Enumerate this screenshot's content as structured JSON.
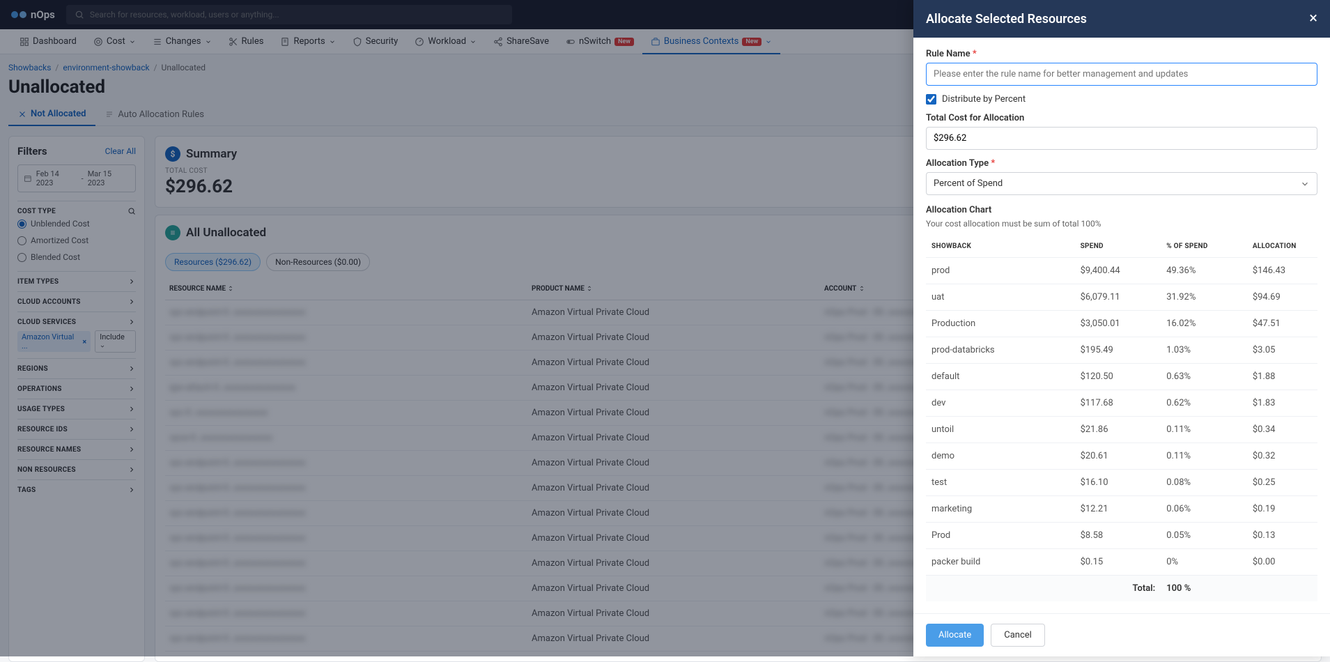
{
  "app": {
    "name": "nOps"
  },
  "search": {
    "placeholder": "Search for resources, workload, users or anything..."
  },
  "nav": {
    "dashboard": "Dashboard",
    "cost": "Cost",
    "changes": "Changes",
    "rules": "Rules",
    "reports": "Reports",
    "security": "Security",
    "workload": "Workload",
    "sharesave": "ShareSave",
    "nswitch": "nSwitch",
    "business": "Business Contexts",
    "badge_new": "New"
  },
  "breadcrumb": {
    "root": "Showbacks",
    "mid": "environment-showback",
    "leaf": "Unallocated",
    "sep": "/"
  },
  "page_title": "Unallocated",
  "tabs": {
    "not": "Not Allocated",
    "auto": "Auto Allocation Rules"
  },
  "filters": {
    "title": "Filters",
    "clear": "Clear All",
    "date_from": "Feb 14 2023",
    "date_sep": "-",
    "date_to": "Mar 15 2023",
    "cost_type": "COST TYPE",
    "opt_unblended": "Unblended Cost",
    "opt_amortized": "Amortized Cost",
    "opt_blended": "Blended Cost",
    "item_types": "ITEM TYPES",
    "cloud_accounts": "CLOUD ACCOUNTS",
    "cloud_services": "CLOUD SERVICES",
    "chip": "Amazon Virtual ...",
    "include": "Include",
    "regions": "REGIONS",
    "operations": "OPERATIONS",
    "usage_types": "USAGE TYPES",
    "resource_ids": "RESOURCE IDS",
    "resource_names": "RESOURCE NAMES",
    "non_resources": "NON RESOURCES",
    "tags": "TAGS"
  },
  "summary": {
    "title": "Summary",
    "total_label": "TOTAL COST",
    "total_value": "$296.62"
  },
  "all": {
    "title": "All Unallocated",
    "pill_resources": "Resources ($296.62)",
    "pill_non": "Non-Resources ($0.00)",
    "th_resource": "Resource Name",
    "th_product": "Product Name",
    "th_account": "Account",
    "product": "Amazon Virtual Private Cloud",
    "rows": [
      "vpc-endpoint-0..",
      "vpc-endpoint-0..",
      "vpc-endpoint-0..",
      "igw-attach-0..",
      "vpc-0..",
      "vpce-0..",
      "vpc-endpoint-0..",
      "vpc-endpoint-0..",
      "vpc-endpoint-0..",
      "vpc-endpoint-0..",
      "vpc-endpoint-0..",
      "vpc-endpoint-0..",
      "vpc-endpoint-0..",
      "vpc-endpoint-0.."
    ],
    "account": "nOps Prod - 00.."
  },
  "panel": {
    "title": "Allocate Selected Resources",
    "rule_name_label": "Rule Name",
    "rule_placeholder": "Please enter the rule name for better management and updates",
    "distribute": "Distribute by Percent",
    "total_cost_label": "Total Cost for Allocation",
    "total_cost_value": "$296.62",
    "alloc_type_label": "Allocation Type",
    "alloc_type_value": "Percent of Spend",
    "chart_title": "Allocation Chart",
    "chart_sub": "Your cost allocation must be sum of total 100%",
    "th_showback": "SHOWBACK",
    "th_spend": "SPEND",
    "th_pct": "% OF SPEND",
    "th_alloc": "ALLOCATION",
    "total_label": "Total:",
    "total_pct": "100 %",
    "btn_allocate": "Allocate",
    "btn_cancel": "Cancel"
  },
  "chart_data": {
    "type": "table",
    "columns": [
      "SHOWBACK",
      "SPEND",
      "% OF SPEND",
      "ALLOCATION"
    ],
    "rows": [
      {
        "showback": "prod",
        "spend": "$9,400.44",
        "pct": "49.36%",
        "alloc": "$146.43"
      },
      {
        "showback": "uat",
        "spend": "$6,079.11",
        "pct": "31.92%",
        "alloc": "$94.69"
      },
      {
        "showback": "Production",
        "spend": "$3,050.01",
        "pct": "16.02%",
        "alloc": "$47.51"
      },
      {
        "showback": "prod-databricks",
        "spend": "$195.49",
        "pct": "1.03%",
        "alloc": "$3.05"
      },
      {
        "showback": "default",
        "spend": "$120.50",
        "pct": "0.63%",
        "alloc": "$1.88"
      },
      {
        "showback": "dev",
        "spend": "$117.68",
        "pct": "0.62%",
        "alloc": "$1.83"
      },
      {
        "showback": "untoil",
        "spend": "$21.86",
        "pct": "0.11%",
        "alloc": "$0.34"
      },
      {
        "showback": "demo",
        "spend": "$20.61",
        "pct": "0.11%",
        "alloc": "$0.32"
      },
      {
        "showback": "test",
        "spend": "$16.10",
        "pct": "0.08%",
        "alloc": "$0.25"
      },
      {
        "showback": "marketing",
        "spend": "$12.21",
        "pct": "0.06%",
        "alloc": "$0.19"
      },
      {
        "showback": "Prod",
        "spend": "$8.58",
        "pct": "0.05%",
        "alloc": "$0.13"
      },
      {
        "showback": "packer build",
        "spend": "$0.15",
        "pct": "0%",
        "alloc": "$0.00"
      }
    ],
    "total_pct": "100 %"
  }
}
